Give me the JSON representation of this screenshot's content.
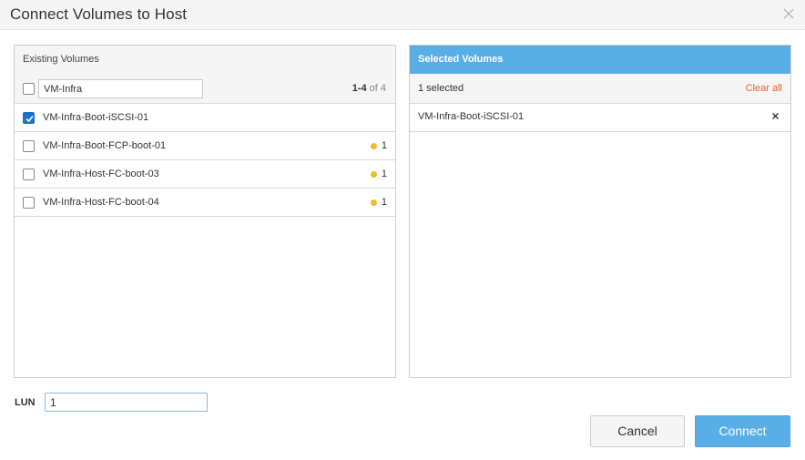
{
  "dialog": {
    "title": "Connect Volumes to Host"
  },
  "existing": {
    "header": "Existing Volumes",
    "filter_value": "VM-Infra",
    "range_bold": "1-4",
    "range_rest": " of 4",
    "rows": [
      {
        "label": "VM-Infra-Boot-iSCSI-01",
        "checked": true,
        "count": ""
      },
      {
        "label": "VM-Infra-Boot-FCP-boot-01",
        "checked": false,
        "count": "1"
      },
      {
        "label": "VM-Infra-Host-FC-boot-03",
        "checked": false,
        "count": "1"
      },
      {
        "label": "VM-Infra-Host-FC-boot-04",
        "checked": false,
        "count": "1"
      }
    ]
  },
  "selected": {
    "header": "Selected Volumes",
    "count_text": "1 selected",
    "clear_all": "Clear all",
    "rows": [
      {
        "label": "VM-Infra-Boot-iSCSI-01"
      }
    ]
  },
  "lun": {
    "label": "LUN",
    "value": "1"
  },
  "buttons": {
    "cancel": "Cancel",
    "connect": "Connect"
  },
  "colors": {
    "accent": "#5aaee6",
    "checkbox": "#1a73c9",
    "clear_link": "#e8632b",
    "status_dot": "#f0b92c"
  },
  "icons": {
    "close": "close-icon",
    "remove": "remove-icon",
    "status": "status-dot-icon",
    "check": "checkmark-icon"
  }
}
